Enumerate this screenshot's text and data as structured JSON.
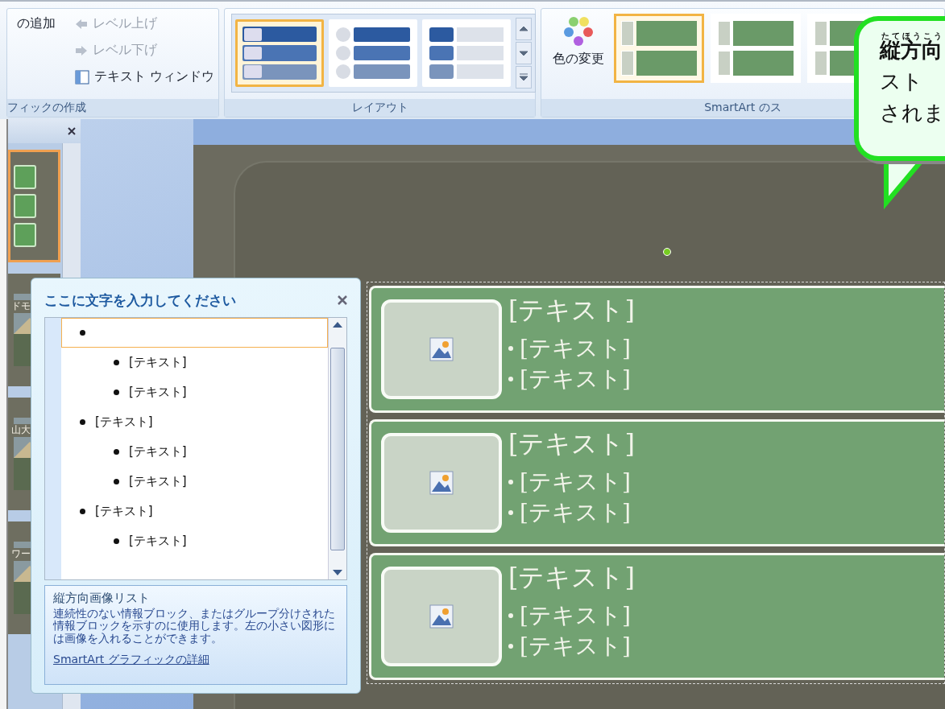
{
  "ribbon": {
    "create_group": {
      "add_button": "の追加",
      "level_buttons": [
        {
          "label": "レベル上げ",
          "disabled": true
        },
        {
          "label": "レベル下げ",
          "disabled": true
        }
      ],
      "text_window_button": "テキスト ウィンドウ",
      "label": "フィックの作成"
    },
    "layout_group": {
      "options": [
        {
          "kind": "bars",
          "selected": true
        },
        {
          "kind": "circles",
          "selected": false
        },
        {
          "kind": "tabs",
          "selected": false
        }
      ],
      "label": "レイアウト"
    },
    "style_group": {
      "color_button": "色の変更",
      "styles": [
        {
          "selected": true
        },
        {
          "selected": false
        },
        {
          "selected": false
        }
      ],
      "label": "SmartArt のス"
    }
  },
  "thumbnails": [
    {
      "kind": "diagram",
      "selected": true
    },
    {
      "caption": "ドモ",
      "selected": false
    },
    {
      "caption": "山大",
      "selected": false
    },
    {
      "caption": "ワー",
      "selected": false
    }
  ],
  "text_pane": {
    "title": "ここに文字を入力してください",
    "items": [
      {
        "selected": true,
        "children": [
          {
            "text": "[テキスト]"
          },
          {
            "text": "[テキスト]"
          }
        ]
      },
      {
        "text": "[テキスト]",
        "selected": false,
        "children": [
          {
            "text": "[テキスト]"
          },
          {
            "text": "[テキスト]"
          }
        ]
      },
      {
        "text": "[テキスト]",
        "selected": false,
        "children": [
          {
            "text": "[テキスト]"
          }
        ]
      }
    ],
    "description": {
      "title": "縦方向画像リスト",
      "body": "連続性のない情報ブロック、またはグループ分けされた情報ブロックを示すのに使用します。左の小さい図形には画像を入れることができます。",
      "link": "SmartArt グラフィックの詳細"
    }
  },
  "diagram": {
    "rows": [
      {
        "title": "[テキスト]",
        "bullets": [
          "[テキスト]",
          "[テキスト]"
        ]
      },
      {
        "title": "[テキスト]",
        "bullets": [
          "[テキスト]",
          "[テキスト]"
        ]
      },
      {
        "title": "[テキスト]",
        "bullets": [
          "[テキスト]",
          "[テキスト]"
        ]
      }
    ]
  },
  "callout": {
    "lines": [
      {
        "text": "縦方向",
        "ruby": "たてほうこう"
      },
      {
        "text": "スト"
      },
      {
        "text": "されま"
      }
    ]
  }
}
